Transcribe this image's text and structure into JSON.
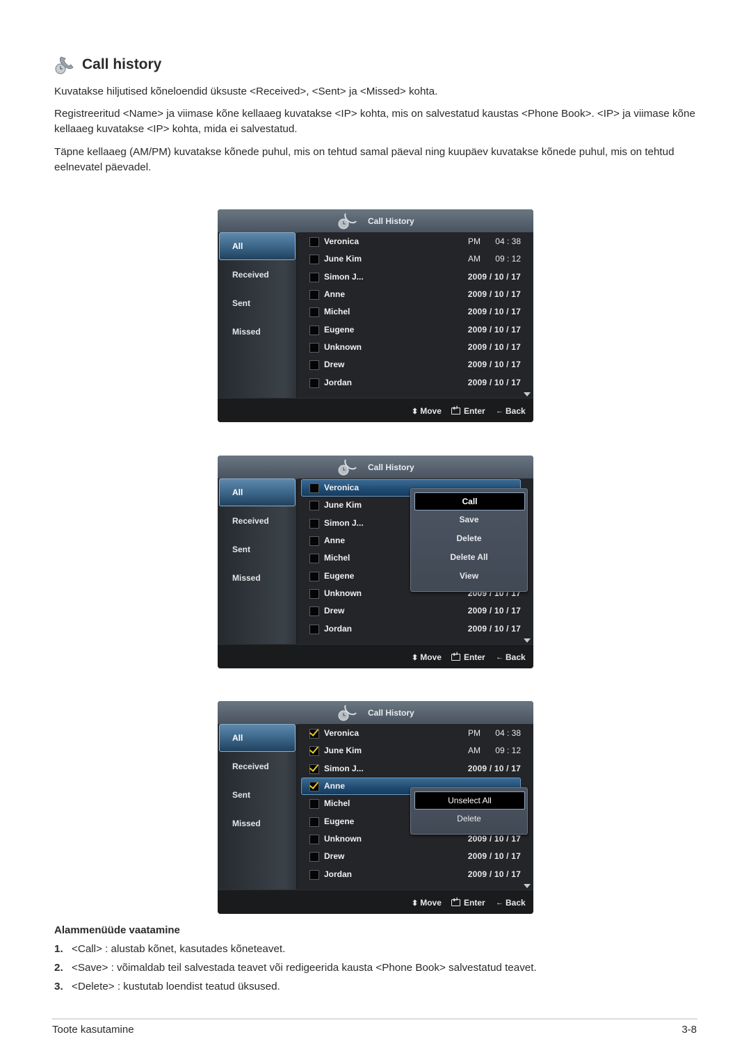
{
  "section": {
    "title": "Call history",
    "icon": "phone-clock-icon",
    "paragraphs": [
      "Kuvatakse hiljutised kõneloendid üksuste <Received>, <Sent> ja <Missed> kohta.",
      "Registreeritud <Name> ja viimase kõne kellaaeg kuvatakse <IP> kohta, mis on salvestatud kaustas <Phone Book>. <IP> ja viimase kõne kellaaeg kuvatakse <IP> kohta, mida ei salvestatud.",
      "Täpne kellaaeg (AM/PM) kuvatakse kõnede puhul, mis on tehtud samal päeval ning kuupäev kuvatakse kõnede puhul, mis on tehtud eelnevatel päevadel."
    ]
  },
  "screens": [
    {
      "header_title": "Call History",
      "sidebar": [
        "All",
        "Received",
        "Sent",
        "Missed"
      ],
      "selected_tab": "All",
      "rows": [
        {
          "name": "Veronica",
          "ampm": "PM",
          "time": "04 : 38",
          "checked": false
        },
        {
          "name": "June Kim",
          "ampm": "AM",
          "time": "09 : 12",
          "checked": false
        },
        {
          "name": "Simon J...",
          "date": "2009 / 10 / 17",
          "checked": false
        },
        {
          "name": "Anne",
          "date": "2009 / 10 / 17",
          "checked": false
        },
        {
          "name": "Michel",
          "date": "2009 / 10 / 17",
          "checked": false
        },
        {
          "name": "Eugene",
          "date": "2009 / 10 / 17",
          "checked": false
        },
        {
          "name": "Unknown",
          "date": "2009 / 10 / 17",
          "checked": false
        },
        {
          "name": "Drew",
          "date": "2009 / 10 / 17",
          "checked": false
        },
        {
          "name": "Jordan",
          "date": "2009 / 10 / 17",
          "checked": false
        }
      ],
      "footer": {
        "move": "Move",
        "enter": "Enter",
        "back": "Back"
      }
    },
    {
      "header_title": "Call History",
      "sidebar": [
        "All",
        "Received",
        "Sent",
        "Missed"
      ],
      "selected_tab": "All",
      "highlighted_row": "Veronica",
      "rows": [
        {
          "name": "Veronica",
          "checked": false
        },
        {
          "name": "June Kim",
          "checked": false
        },
        {
          "name": "Simon J...",
          "checked": false
        },
        {
          "name": "Anne",
          "checked": false
        },
        {
          "name": "Michel",
          "checked": false
        },
        {
          "name": "Eugene",
          "checked": false
        },
        {
          "name": "Unknown",
          "date": "2009 / 10 / 17",
          "checked": false
        },
        {
          "name": "Drew",
          "date": "2009 / 10 / 17",
          "checked": false
        },
        {
          "name": "Jordan",
          "date": "2009 / 10 / 17",
          "checked": false
        }
      ],
      "popup": {
        "items": [
          "Call",
          "Save",
          "Delete",
          "Delete All",
          "View"
        ],
        "active": "Call"
      },
      "footer": {
        "move": "Move",
        "enter": "Enter",
        "back": "Back"
      }
    },
    {
      "header_title": "Call History",
      "sidebar": [
        "All",
        "Received",
        "Sent",
        "Missed"
      ],
      "selected_tab": "All",
      "highlighted_row": "Anne",
      "rows": [
        {
          "name": "Veronica",
          "ampm": "PM",
          "time": "04 : 38",
          "checked": true
        },
        {
          "name": "June Kim",
          "ampm": "AM",
          "time": "09 : 12",
          "checked": true
        },
        {
          "name": "Simon J...",
          "date": "2009 / 10 / 17",
          "checked": true
        },
        {
          "name": "Anne",
          "checked": true
        },
        {
          "name": "Michel",
          "checked": false
        },
        {
          "name": "Eugene",
          "checked": false
        },
        {
          "name": "Unknown",
          "date": "2009 / 10 / 17",
          "checked": false
        },
        {
          "name": "Drew",
          "date": "2009 / 10 / 17",
          "checked": false
        },
        {
          "name": "Jordan",
          "date": "2009 / 10 / 17",
          "checked": false
        }
      ],
      "popup": {
        "items": [
          "Unselect All",
          "Delete"
        ],
        "active": "Unselect All"
      },
      "footer": {
        "move": "Move",
        "enter": "Enter",
        "back": "Back"
      }
    }
  ],
  "submenu": {
    "heading": "Alammenüüde vaatamine",
    "items": [
      {
        "num": "1.",
        "text": "<Call> : alustab kõnet, kasutades kõneteavet."
      },
      {
        "num": "2.",
        "text": "<Save> : võimaldab teil salvestada teavet või redigeerida kausta <Phone Book> salvestatud teavet."
      },
      {
        "num": "3.",
        "text": "<Delete> : kustutab loendist teatud üksused."
      }
    ]
  },
  "page_footer": {
    "section": "Toote kasutamine",
    "page": "3-8"
  }
}
